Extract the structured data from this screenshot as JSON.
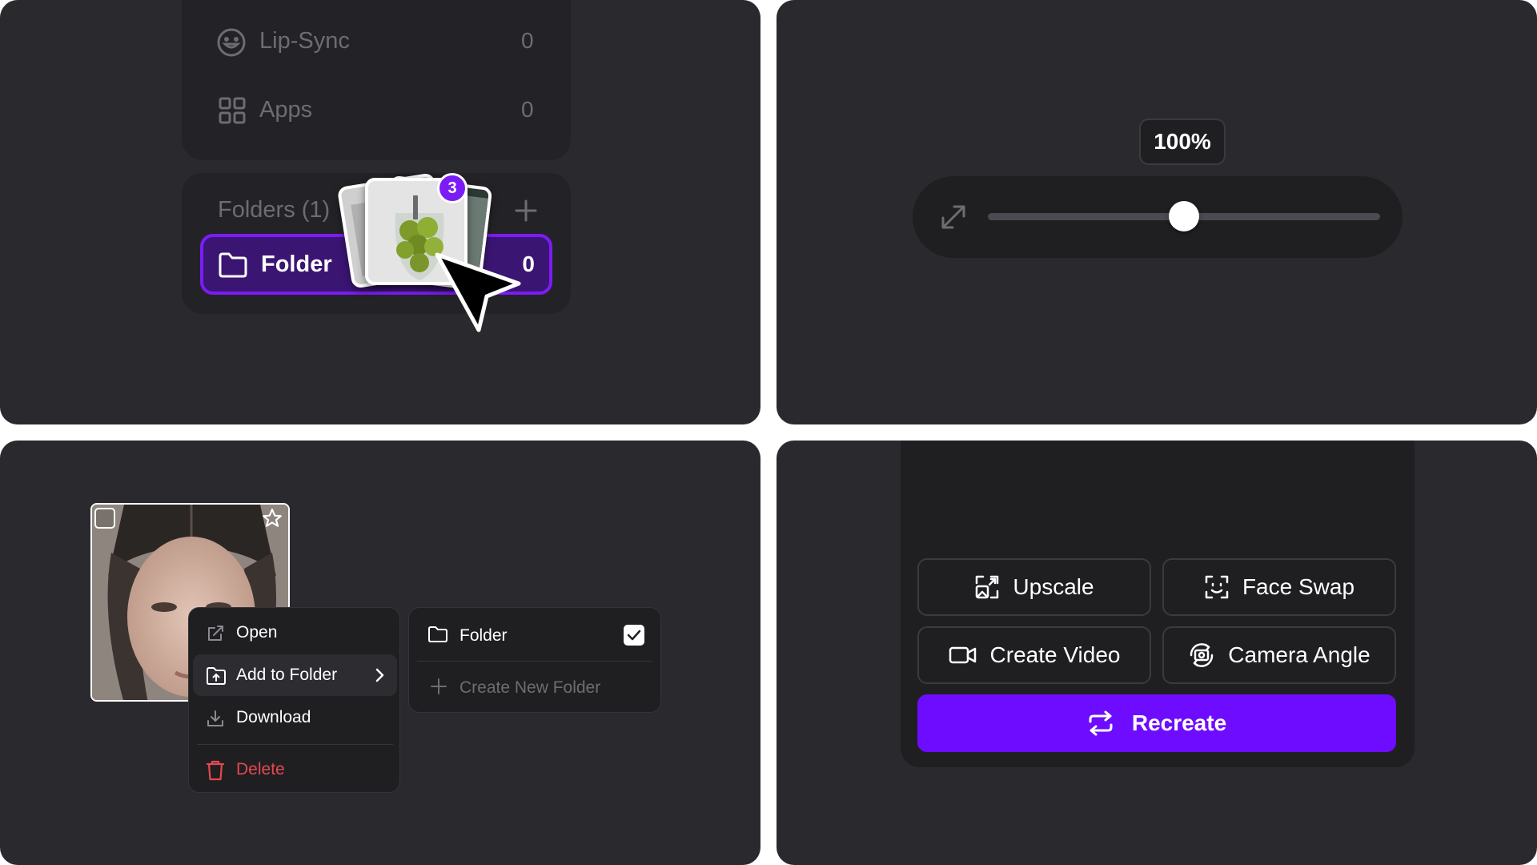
{
  "panel1": {
    "nav_items": [
      {
        "label": "Lip-Sync",
        "count": "0",
        "icon": "smile-icon"
      },
      {
        "label": "Apps",
        "count": "0",
        "icon": "grid-icon"
      }
    ],
    "folders_header": "Folders (1)",
    "folder": {
      "label": "Folder",
      "count": "0"
    },
    "drag_badge": "3",
    "accent": "#7b1cf5"
  },
  "panel2": {
    "zoom_label": "100%",
    "slider_value": 0.5
  },
  "panel3": {
    "context_menu": {
      "open": "Open",
      "add_to_folder": "Add to Folder",
      "download": "Download",
      "delete": "Delete"
    },
    "submenu": {
      "folder": "Folder",
      "create_new_folder": "Create New Folder"
    },
    "delete_color": "#e5484d"
  },
  "panel4": {
    "actions": {
      "upscale": "Upscale",
      "face_swap": "Face Swap",
      "create_video": "Create Video",
      "camera_angle": "Camera Angle"
    },
    "recreate": "Recreate",
    "primary_color": "#6e0cff"
  }
}
